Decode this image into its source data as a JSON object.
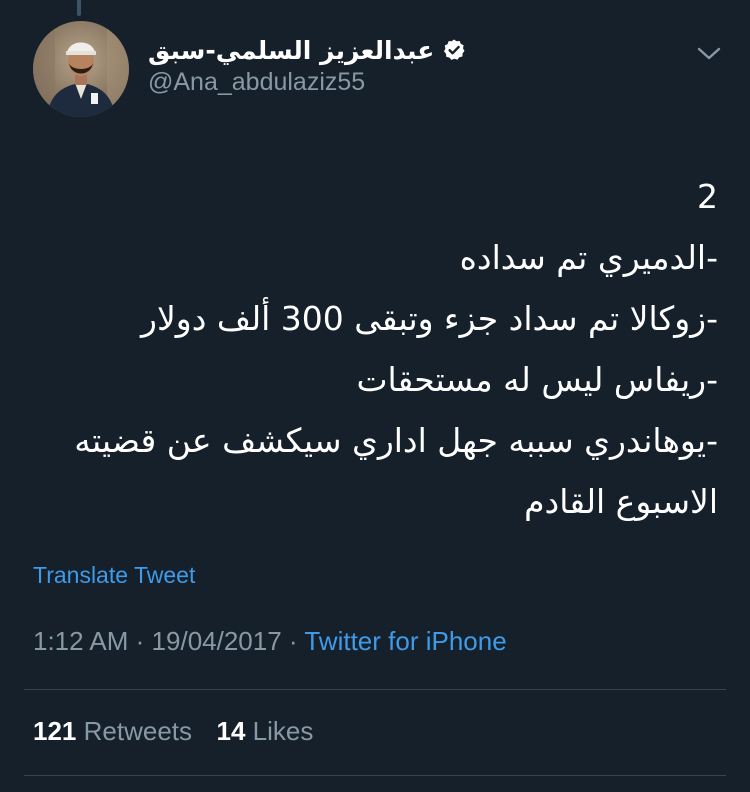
{
  "author": {
    "display_name": "عبدالعزيز السلمي-سبق",
    "handle": "@Ana_abdulaziz55",
    "verified": true,
    "verified_icon": "verified-badge-icon"
  },
  "menu_icon": "chevron-down-icon",
  "tweet": {
    "lines": [
      "2",
      "-الدميري تم سداده",
      "-زوكالا تم سداد جزء وتبقى 300 ألف دولار",
      "-ريفاس ليس له مستحقات",
      "-يوهاندري سببه جهل اداري سيكشف عن قضيته",
      "الاسبوع القادم"
    ]
  },
  "translate_label": "Translate Tweet",
  "meta": {
    "time": "1:12 AM",
    "separator": "·",
    "date": "19/04/2017",
    "source": "Twitter for iPhone"
  },
  "stats": {
    "retweets_count": "121",
    "retweets_label": "Retweets",
    "likes_count": "14",
    "likes_label": "Likes"
  },
  "colors": {
    "background": "#15202b",
    "text": "#ffffff",
    "secondary_text": "#8899a6",
    "link": "#3f9ae8",
    "divider": "#38444d"
  }
}
